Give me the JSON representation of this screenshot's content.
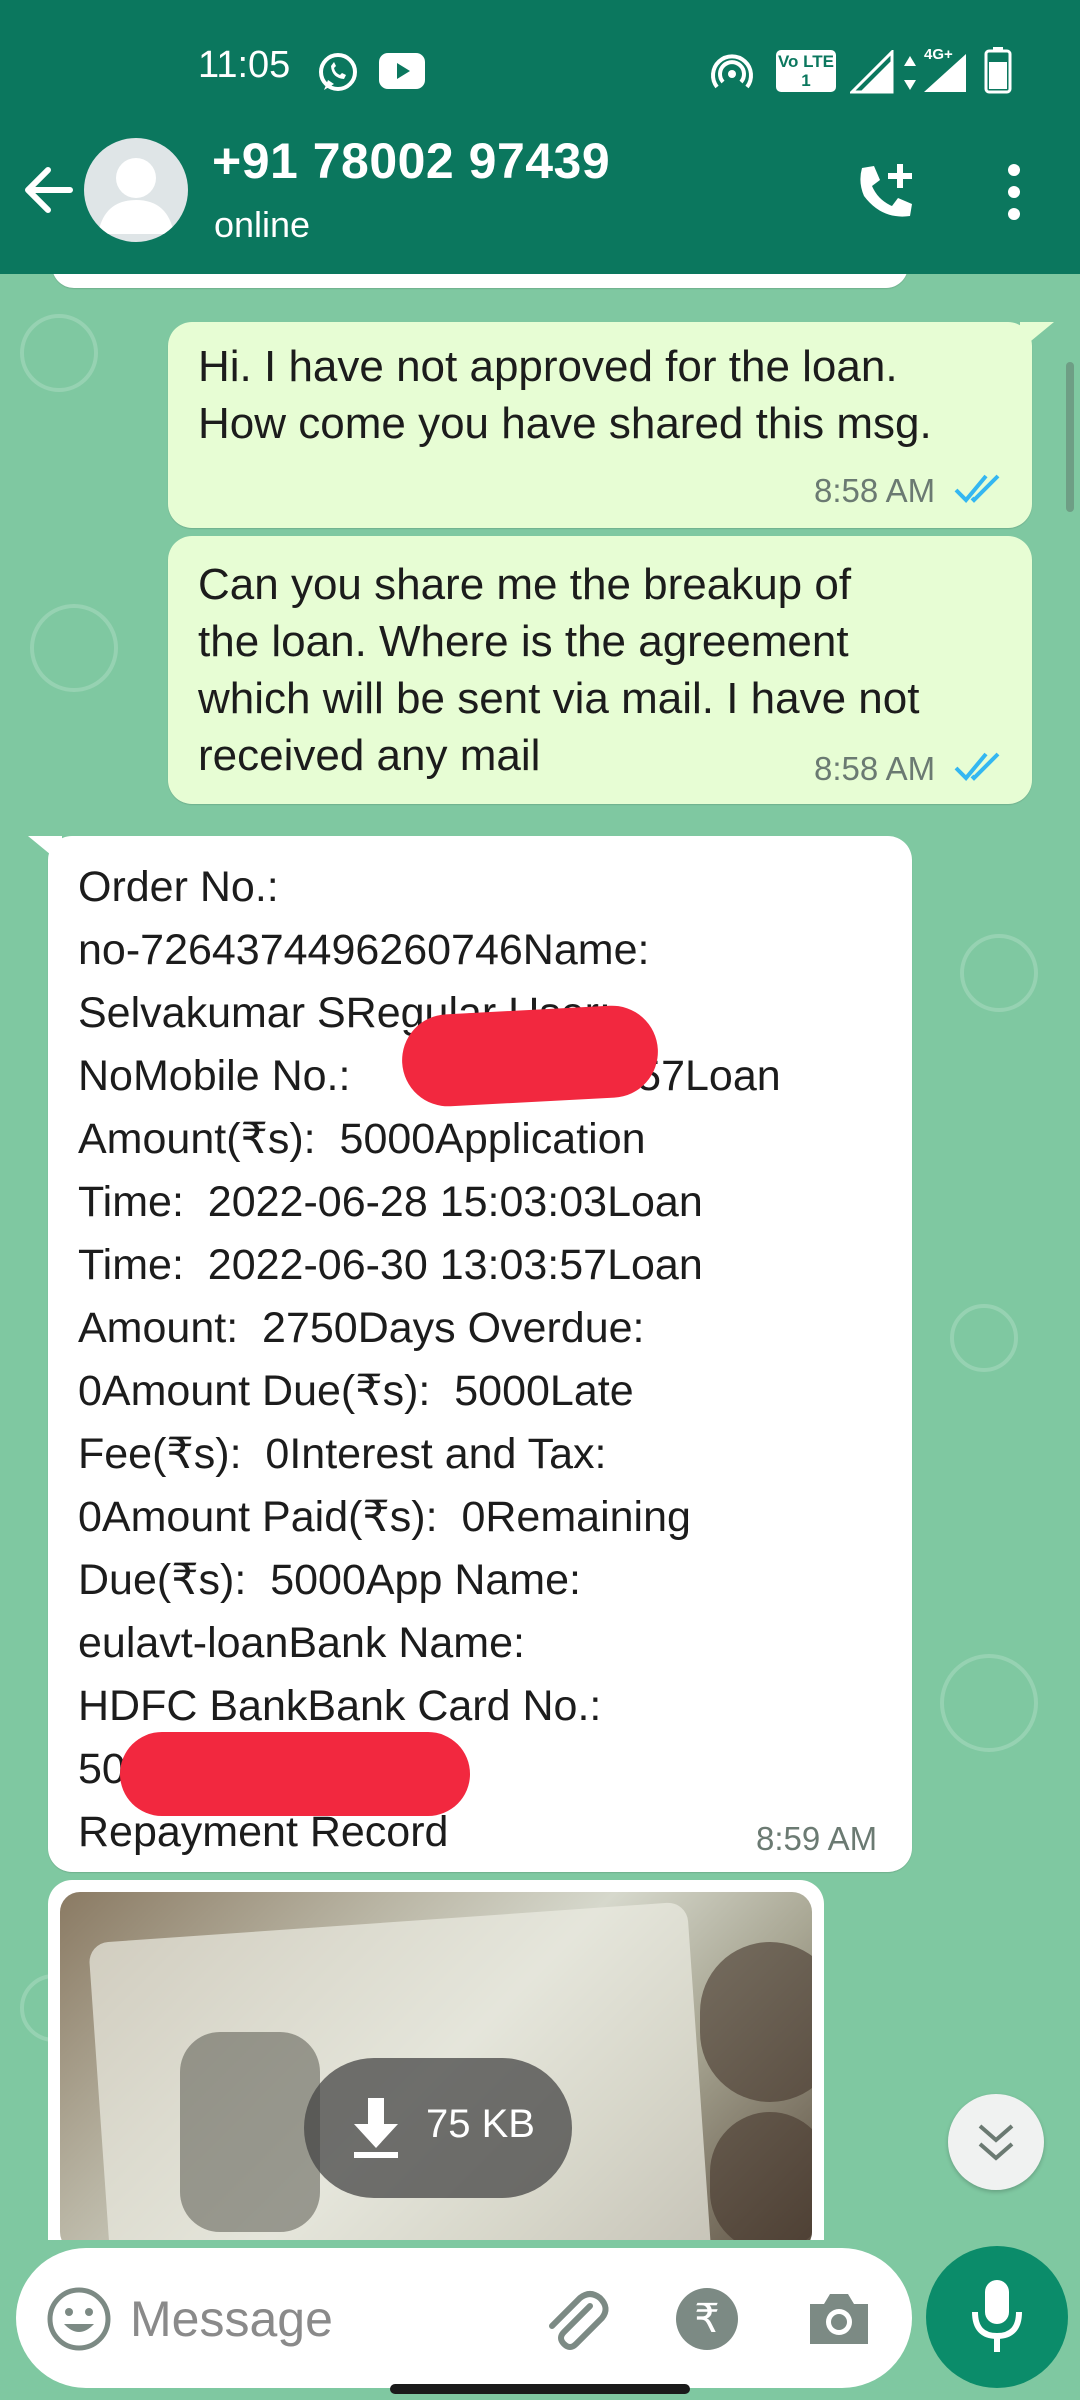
{
  "status_bar": {
    "time": "11:05",
    "network_label": "4G+",
    "volte_label": "Vo LTE 1",
    "icons": [
      "whatsapp-icon",
      "youtube-icon",
      "hotspot-icon",
      "volte-icon",
      "signal-icon",
      "data-arrows-icon",
      "signal-4g-icon",
      "battery-icon"
    ]
  },
  "header": {
    "contact_name": "+91 78002 97439",
    "contact_status": "online",
    "icons": [
      "back-arrow-icon",
      "avatar-icon",
      "add-call-icon",
      "more-vert-icon"
    ]
  },
  "messages": [
    {
      "direction": "out",
      "text": "Hi. I have not approved for the loan.\nHow come you have shared this msg.",
      "time": "8:58 AM",
      "status": "read"
    },
    {
      "direction": "out",
      "text": "Can you share me the breakup of\nthe loan. Where is the agreement\nwhich will be sent via mail. I have not\nreceived any mail",
      "time": "8:58 AM",
      "status": "read"
    },
    {
      "direction": "in",
      "text": "Order No.:\nno-7264374496260746Name:\nSelvakumar SRegular User:\nNoMobile No.:                        57Loan\nAmount(₹s):  5000Application\nTime:  2022-06-28 15:03:03Loan\nTime:  2022-06-30 13:03:57Loan\nAmount:  2750Days Overdue:\n0Amount Due(₹s):  5000Late\nFee(₹s):  0Interest and Tax:\n0Amount Paid(₹s):  0Remaining\nDue(₹s):  5000App Name:\neulavt-loanBank Name:\nHDFC BankBank Card No.:\n50\nRepayment Record",
      "time": "8:59 AM"
    },
    {
      "direction": "in",
      "type": "image",
      "download_size": "75 KB"
    }
  ],
  "input": {
    "placeholder": "Message",
    "icons": [
      "emoji-icon",
      "attach-icon",
      "rupee-payment-icon",
      "camera-icon",
      "mic-icon"
    ]
  },
  "scroll_down_icon": "double-chevron-down-icon",
  "colors": {
    "header": "#0b775e",
    "chat_background": "#7fc8a1",
    "outgoing_bubble": "#e7fdd4",
    "incoming_bubble": "#ffffff",
    "read_ticks": "#34b7f1",
    "mic_button": "#0b8c6a",
    "redaction": "#f2283f"
  }
}
